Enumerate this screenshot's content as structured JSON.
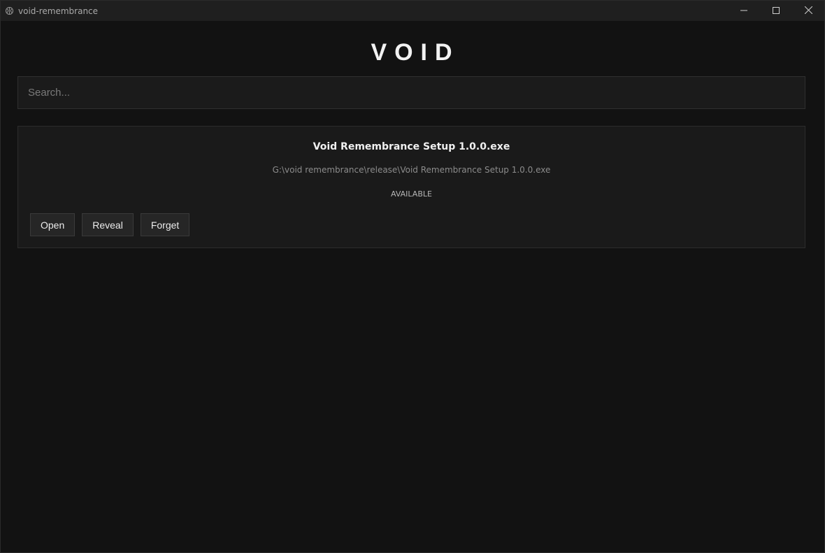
{
  "window": {
    "title": "void-remembrance",
    "app_icon": "brain-icon",
    "controls": [
      "minimize-icon",
      "maximize-icon",
      "close-icon"
    ]
  },
  "header": {
    "logo": "VOID"
  },
  "search": {
    "placeholder": "Search...",
    "value": ""
  },
  "items": [
    {
      "name": "Void Remembrance Setup 1.0.0.exe",
      "path": "G:\\void remembrance\\release\\Void Remembrance Setup 1.0.0.exe",
      "status": "AVAILABLE",
      "actions": {
        "open": "Open",
        "reveal": "Reveal",
        "forget": "Forget"
      }
    }
  ],
  "colors": {
    "background": "#121212",
    "titlebar": "#1f1f1f",
    "card": "#1a1a1a",
    "button": "#262626",
    "text": "#f0f0f0"
  }
}
